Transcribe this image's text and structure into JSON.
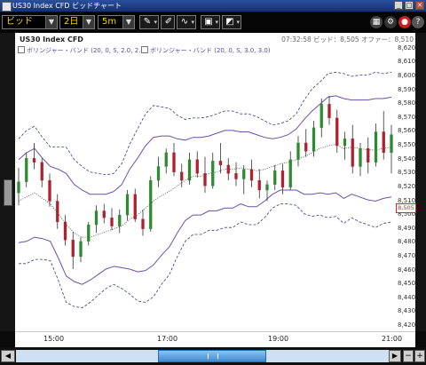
{
  "window": {
    "title": "US30 Index CFD ビッドチャート",
    "min_btn": "_",
    "max_btn": "□",
    "close_btn": "✕"
  },
  "toolbar": {
    "side_select": "ビッド",
    "period_select": "2日",
    "interval_select": "5m",
    "tools": [
      "draw-line-tool",
      "pin-tool",
      "indicator-tool",
      "camera-tool",
      "chart-type-tool"
    ]
  },
  "chart": {
    "symbol": "US30 Index CFD",
    "quote": "07:32:58 ビッド：8,505 オファー：8,510",
    "indicator1": "ボリンジャー・バンド (20, 0, S, 2.0, 2.0)",
    "indicator2": "ボリンジャー・バンド (20, 0, S, 3.0, 3.0)",
    "last_price": "8,505",
    "colors": {
      "up": "#2e8b32",
      "down": "#b0202e",
      "band": "#6a51a8",
      "band_outer": "#3a3a8a"
    }
  },
  "chart_data": {
    "type": "candlestick",
    "y_axis_labels": [
      "8,620",
      "8,610",
      "8,600",
      "8,590",
      "8,580",
      "8,570",
      "8,560",
      "8,550",
      "8,540",
      "8,530",
      "8,520",
      "8,510",
      "8,500",
      "8,490",
      "8,480",
      "8,470",
      "8,460",
      "8,450",
      "8,440",
      "8,430",
      "8,420"
    ],
    "x_axis_labels": [
      "15:00",
      "17:00",
      "19:00",
      "21:00"
    ],
    "ylim": [
      8420,
      8625
    ],
    "candles": [
      [
        8516,
        8534,
        8507,
        8524
      ],
      [
        8524,
        8545,
        8520,
        8541
      ],
      [
        8541,
        8552,
        8533,
        8538
      ],
      [
        8538,
        8541,
        8520,
        8525
      ],
      [
        8525,
        8530,
        8506,
        8510
      ],
      [
        8510,
        8515,
        8490,
        8495
      ],
      [
        8495,
        8500,
        8478,
        8482
      ],
      [
        8482,
        8488,
        8461,
        8470
      ],
      [
        8470,
        8484,
        8466,
        8481
      ],
      [
        8481,
        8495,
        8478,
        8493
      ],
      [
        8493,
        8507,
        8487,
        8503
      ],
      [
        8503,
        8508,
        8494,
        8498
      ],
      [
        8498,
        8505,
        8489,
        8492
      ],
      [
        8492,
        8504,
        8487,
        8500
      ],
      [
        8500,
        8518,
        8496,
        8515
      ],
      [
        8515,
        8519,
        8495,
        8497
      ],
      [
        8497,
        8504,
        8485,
        8490
      ],
      [
        8490,
        8528,
        8488,
        8525
      ],
      [
        8525,
        8542,
        8520,
        8535
      ],
      [
        8535,
        8548,
        8530,
        8545
      ],
      [
        8545,
        8552,
        8528,
        8531
      ],
      [
        8531,
        8537,
        8520,
        8525
      ],
      [
        8525,
        8545,
        8522,
        8540
      ],
      [
        8540,
        8546,
        8527,
        8530
      ],
      [
        8530,
        8542,
        8516,
        8521
      ],
      [
        8521,
        8545,
        8519,
        8539
      ],
      [
        8539,
        8552,
        8530,
        8536
      ],
      [
        8536,
        8541,
        8525,
        8530
      ],
      [
        8530,
        8538,
        8521,
        8526
      ],
      [
        8526,
        8536,
        8515,
        8533
      ],
      [
        8533,
        8540,
        8520,
        8525
      ],
      [
        8525,
        8533,
        8512,
        8518
      ],
      [
        8518,
        8525,
        8510,
        8522
      ],
      [
        8522,
        8536,
        8518,
        8532
      ],
      [
        8532,
        8537,
        8515,
        8520
      ],
      [
        8520,
        8546,
        8518,
        8540
      ],
      [
        8540,
        8557,
        8535,
        8552
      ],
      [
        8552,
        8562,
        8542,
        8546
      ],
      [
        8546,
        8568,
        8542,
        8563
      ],
      [
        8563,
        8584,
        8556,
        8580
      ],
      [
        8580,
        8586,
        8565,
        8570
      ],
      [
        8570,
        8576,
        8545,
        8550
      ],
      [
        8550,
        8560,
        8540,
        8555
      ],
      [
        8555,
        8565,
        8530,
        8535
      ],
      [
        8535,
        8552,
        8528,
        8548
      ],
      [
        8548,
        8556,
        8530,
        8538
      ],
      [
        8538,
        8566,
        8535,
        8560
      ],
      [
        8560,
        8575,
        8540,
        8545
      ],
      [
        8545,
        8565,
        8530,
        8558
      ]
    ],
    "bands": {
      "mid": [
        8510,
        8513,
        8516,
        8512,
        8508,
        8501,
        8493,
        8487,
        8484,
        8484,
        8486,
        8488,
        8490,
        8492,
        8497,
        8500,
        8505,
        8510,
        8514,
        8517,
        8521,
        8525,
        8528,
        8528,
        8530,
        8531,
        8533,
        8533,
        8534,
        8533,
        8532,
        8533,
        8535,
        8537,
        8538,
        8540,
        8542,
        8545,
        8548,
        8550,
        8551,
        8548,
        8549,
        8548,
        8547,
        8547,
        8548,
        8549
      ],
      "up2": [
        8540,
        8545,
        8548,
        8541,
        8535,
        8533,
        8530,
        8522,
        8518,
        8515,
        8515,
        8515,
        8517,
        8522,
        8533,
        8541,
        8550,
        8556,
        8557,
        8557,
        8555,
        8554,
        8556,
        8556,
        8557,
        8559,
        8561,
        8561,
        8560,
        8560,
        8558,
        8556,
        8555,
        8556,
        8558,
        8562,
        8569,
        8575,
        8580,
        8585,
        8586,
        8584,
        8583,
        8583,
        8583,
        8584,
        8584,
        8585
      ],
      "lo2": [
        8480,
        8481,
        8484,
        8483,
        8481,
        8469,
        8456,
        8452,
        8450,
        8453,
        8457,
        8461,
        8463,
        8462,
        8461,
        8459,
        8460,
        8464,
        8471,
        8477,
        8487,
        8496,
        8500,
        8500,
        8503,
        8503,
        8505,
        8505,
        8508,
        8506,
        8506,
        8510,
        8515,
        8518,
        8518,
        8518,
        8515,
        8515,
        8516,
        8515,
        8516,
        8512,
        8515,
        8513,
        8511,
        8510,
        8512,
        8513
      ],
      "up3": [
        8555,
        8561,
        8564,
        8556,
        8549,
        8549,
        8549,
        8540,
        8535,
        8531,
        8530,
        8529,
        8530,
        8537,
        8551,
        8562,
        8573,
        8579,
        8578,
        8577,
        8572,
        8569,
        8570,
        8570,
        8571,
        8573,
        8575,
        8575,
        8573,
        8573,
        8571,
        8568,
        8565,
        8566,
        8568,
        8573,
        8583,
        8591,
        8596,
        8602,
        8603,
        8602,
        8600,
        8601,
        8601,
        8603,
        8602,
        8603
      ],
      "lo3": [
        8465,
        8465,
        8468,
        8468,
        8467,
        8453,
        8437,
        8434,
        8433,
        8437,
        8442,
        8447,
        8450,
        8447,
        8443,
        8438,
        8437,
        8441,
        8450,
        8457,
        8470,
        8481,
        8486,
        8486,
        8489,
        8489,
        8491,
        8491,
        8495,
        8493,
        8493,
        8498,
        8505,
        8508,
        8508,
        8507,
        8501,
        8499,
        8500,
        8498,
        8499,
        8494,
        8498,
        8495,
        8493,
        8491,
        8494,
        8495
      ]
    }
  }
}
